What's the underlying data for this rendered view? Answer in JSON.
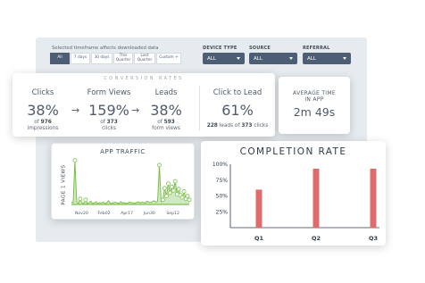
{
  "filters": {
    "hint": "Selected timeframe affects downloaded data",
    "timeframe": [
      "All",
      "7 days",
      "30 days",
      "This\nQuarter",
      "Last\nQuarter",
      "Custom +"
    ],
    "active_timeframe": "All",
    "device_type": {
      "label": "DEVICE TYPE",
      "value": "ALL"
    },
    "source": {
      "label": "SOURCE",
      "value": "ALL"
    },
    "referral": {
      "label": "REFERRAL",
      "value": "ALL"
    }
  },
  "conversion": {
    "title": "CONVERSION RATES",
    "clicks": {
      "label": "Clicks",
      "value": "38%",
      "sub_prefix": "of",
      "sub_count": "976",
      "sub_unit": "impressions"
    },
    "form_views": {
      "label": "Form Views",
      "value": "159%",
      "sub_prefix": "of",
      "sub_count": "373",
      "sub_unit": "clicks"
    },
    "leads": {
      "label": "Leads",
      "value": "38%",
      "sub_prefix": "of",
      "sub_count": "593",
      "sub_unit": "form views"
    },
    "click_to_lead": {
      "label": "Click to Lead",
      "value": "61%",
      "sub_count_a": "228",
      "sub_mid": "leads of",
      "sub_count_b": "373",
      "sub_unit": "clicks"
    }
  },
  "avg_time": {
    "label": "AVERAGE TIME\nIN APP",
    "value": "2m 49s"
  },
  "traffic": {
    "title": "APP TRAFFIC",
    "ylabel": "PAGE 1 VIEWS"
  },
  "colors": {
    "accent": "#4d5d73",
    "traffic_line": "#7cc04b",
    "bar": "#e06b6b"
  },
  "chart_data": [
    {
      "type": "line",
      "title": "APP TRAFFIC",
      "xlabel": "",
      "ylabel": "PAGE 1 VIEWS",
      "x_ticks": [
        "Nov20",
        "Feb02",
        "Apr17",
        "Jun30",
        "Sep12"
      ],
      "series": [
        {
          "values": [
            0.05,
            0.04,
            0.95,
            0.06,
            0.02,
            0.12,
            0.03,
            0.02,
            0.1,
            0.02,
            0.04,
            0.07,
            0.02,
            0.03,
            0.06,
            0.02,
            0.04,
            0.03,
            0.05,
            0.02,
            0.03,
            0.08,
            0.03,
            0.02,
            0.04,
            0.05,
            0.03,
            0.02,
            0.06,
            0.03,
            0.04,
            0.02,
            0.03,
            0.05,
            0.04,
            0.03,
            0.02,
            0.04,
            0.06,
            0.03,
            0.05,
            0.04,
            0.03,
            0.07,
            0.05,
            0.04,
            0.06,
            0.08,
            0.05,
            0.07,
            0.85,
            0.06,
            0.1,
            0.35,
            0.18,
            0.45,
            0.25,
            0.38,
            0.3,
            0.5,
            0.22,
            0.33,
            0.2,
            0.15,
            0.28,
            0.12,
            0.18,
            0.1
          ]
        }
      ]
    },
    {
      "type": "bar",
      "title": "COMPLETION RATE",
      "categories": [
        "Q1",
        "Q2",
        "Q3"
      ],
      "values": [
        60,
        93,
        93
      ],
      "ylim": [
        0,
        100
      ],
      "y_ticks": [
        "100%",
        "75%",
        "50%",
        "25%"
      ]
    }
  ]
}
